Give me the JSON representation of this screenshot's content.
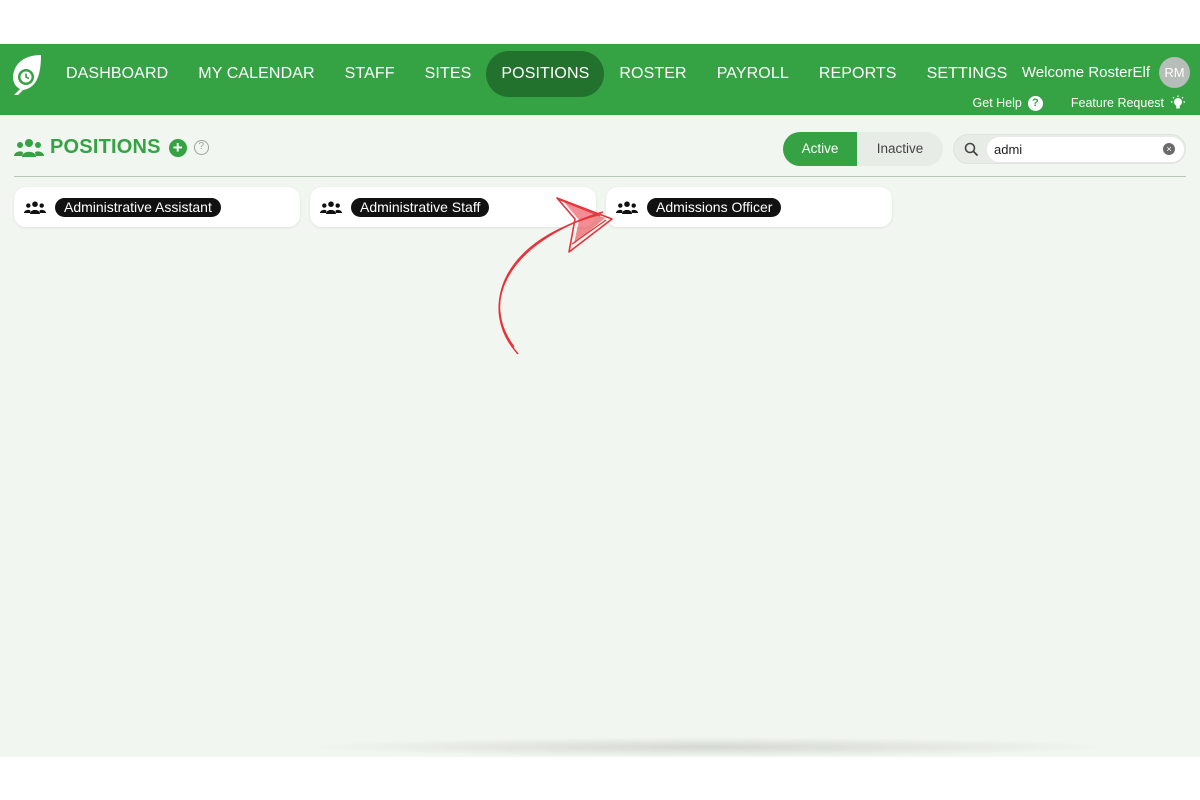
{
  "colors": {
    "brand_green": "#35a244",
    "nav_active": "#22722e",
    "arrow_red": "#e8323a"
  },
  "nav": {
    "items": [
      {
        "label": "DASHBOARD"
      },
      {
        "label": "MY CALENDAR"
      },
      {
        "label": "STAFF"
      },
      {
        "label": "SITES"
      },
      {
        "label": "POSITIONS",
        "active": true
      },
      {
        "label": "ROSTER"
      },
      {
        "label": "PAYROLL"
      },
      {
        "label": "REPORTS"
      },
      {
        "label": "SETTINGS"
      }
    ]
  },
  "user": {
    "welcome": "Welcome RosterElf",
    "initials": "RM"
  },
  "help": {
    "get_help": "Get Help",
    "help_icon": "?",
    "feature_request": "Feature Request"
  },
  "page": {
    "title": "POSITIONS",
    "add_icon": "+",
    "info_icon": "?"
  },
  "filter": {
    "active_label": "Active",
    "inactive_label": "Inactive",
    "selected": "Active"
  },
  "search": {
    "value": "admi",
    "clear_icon": "×"
  },
  "positions": [
    {
      "name": "Administrative Assistant"
    },
    {
      "name": "Administrative Staff"
    },
    {
      "name": "Admissions Officer"
    }
  ]
}
